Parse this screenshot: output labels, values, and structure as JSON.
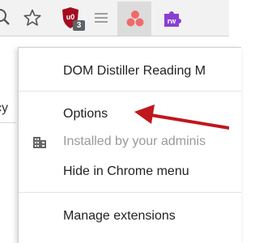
{
  "toolbar": {
    "icons": [
      "search-icon",
      "star-icon",
      "ublock-origin-icon",
      "reader-icon",
      "asana-icon",
      "rw-icon"
    ],
    "ublock_badge": "3",
    "rw_label": "rw"
  },
  "page": {
    "fragment_text": "cy"
  },
  "menu": {
    "items": [
      {
        "label": "DOM Distiller Reading M",
        "enabled": true
      },
      {
        "label": "Options",
        "enabled": true
      },
      {
        "label": "Installed by your adminis",
        "enabled": false,
        "icon": "building-icon"
      },
      {
        "label": "Hide in Chrome menu",
        "enabled": true
      },
      {
        "label": "Manage extensions",
        "enabled": true
      }
    ]
  },
  "annotation": {
    "arrow_color": "#c0171c"
  },
  "colors": {
    "toolbar_bg": "#f2f2f2",
    "ublock_red": "#a30d1f",
    "asana_pink": "#f06a6a",
    "rw_purple": "#8a3fd1",
    "disabled_text": "#9a9a9a"
  }
}
